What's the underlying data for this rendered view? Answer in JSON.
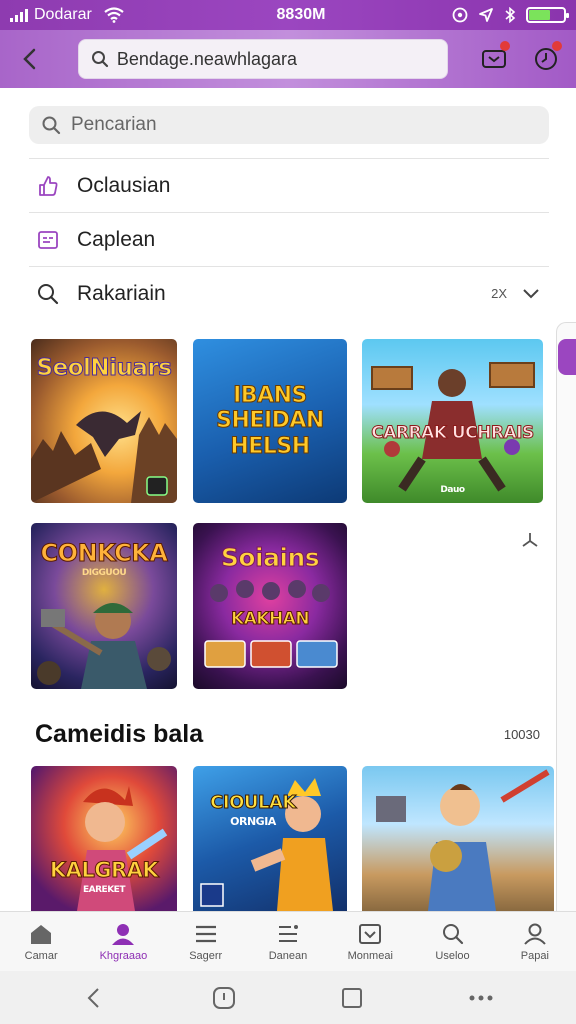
{
  "status_bar": {
    "carrier": "Dodarar",
    "time": "8830M"
  },
  "app_bar": {
    "address": "Bendage.neawhlagara",
    "icons": [
      "back-icon",
      "chat-badge-icon",
      "clock-badge-icon"
    ]
  },
  "search": {
    "placeholder": "Pencarian"
  },
  "menu": [
    {
      "label": "Oclausian",
      "icon": "thumb-up-icon"
    },
    {
      "label": "Caplean",
      "icon": "card-icon"
    },
    {
      "label": "Rakariain",
      "icon": "search-icon",
      "count": "2X",
      "expand": "chevron-down-icon"
    }
  ],
  "game_tiles_top": [
    {
      "title": "SeolNiuars",
      "caption": ""
    },
    {
      "title": "IBANS SHEIDAN HELSH",
      "caption": ""
    },
    {
      "title": "CARRAK UCHRAIS",
      "caption": "Dauo"
    },
    {
      "title": "CONKCKA",
      "caption": "DIGGUOU"
    },
    {
      "title": "Soiains",
      "caption": "KAKHAN"
    }
  ],
  "section": {
    "heading": "Cameidis bala",
    "count": "10030"
  },
  "game_tiles_bottom": [
    {
      "title": "KALGRAK",
      "caption": "EAREKET"
    },
    {
      "title": "CIOULAK",
      "caption": "ORNGIA"
    },
    {
      "title": "",
      "caption": ""
    }
  ],
  "bottom_nav": [
    {
      "label": "Camar",
      "icon": "home-icon",
      "active": false
    },
    {
      "label": "Khgraaao",
      "icon": "person-icon",
      "active": true
    },
    {
      "label": "Sagerr",
      "icon": "menu-icon",
      "active": false
    },
    {
      "label": "Danean",
      "icon": "list-icon",
      "active": false
    },
    {
      "label": "Monmeai",
      "icon": "inbox-icon",
      "active": false
    },
    {
      "label": "Useloo",
      "icon": "search-icon",
      "active": false
    },
    {
      "label": "Papai",
      "icon": "profile-icon",
      "active": false
    }
  ],
  "colors": {
    "brand": "#9b46c0",
    "accent_active": "#8e2fb4",
    "badge": "#e23a3a"
  }
}
